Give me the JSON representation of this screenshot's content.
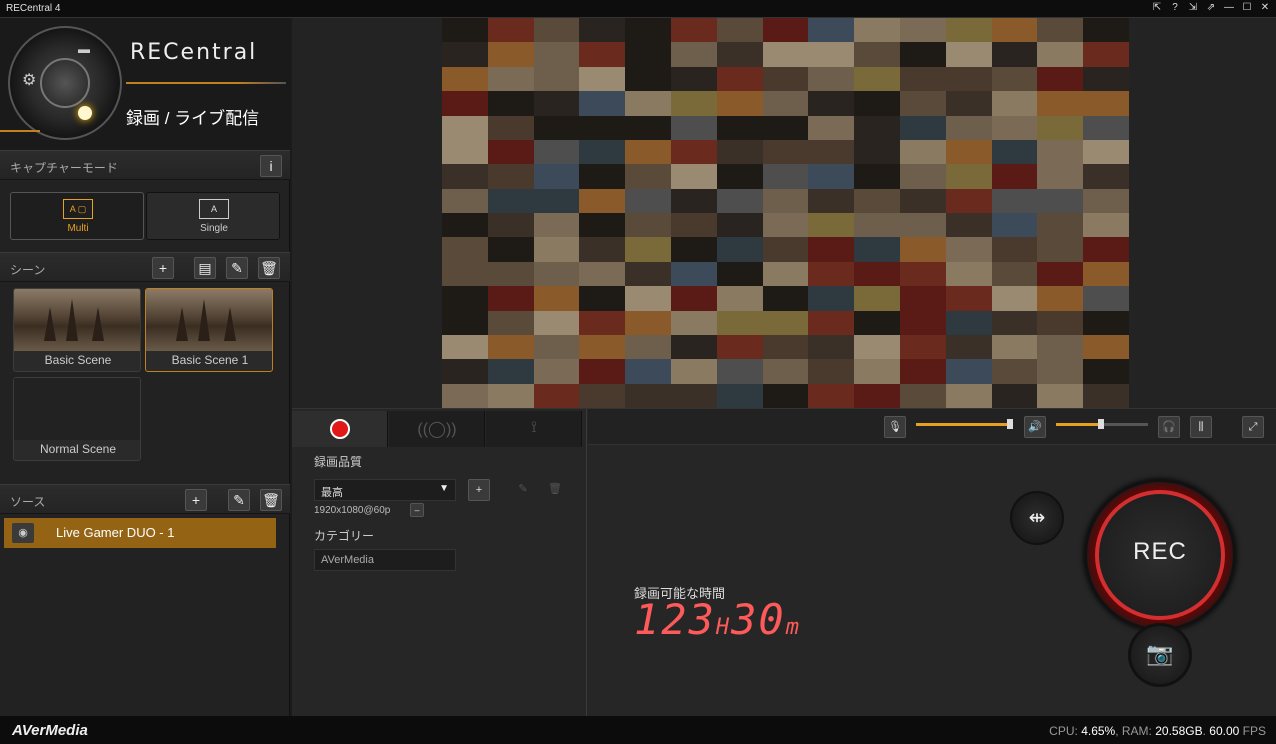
{
  "window": {
    "title": "RECentral 4",
    "controls": [
      "⇱",
      "?",
      "⇲",
      "⇗",
      "—",
      "☐",
      "✕"
    ]
  },
  "brand": {
    "logo": "RECentral",
    "mode": "録画 / ライブ配信"
  },
  "capture_mode": {
    "label": "キャプチャーモード",
    "info": "i",
    "options": [
      {
        "icon": "A ▢",
        "label": "Multi",
        "selected": true
      },
      {
        "icon": "A",
        "label": "Single",
        "selected": false
      }
    ]
  },
  "scenes": {
    "label": "シーン",
    "items": [
      {
        "name": "Basic Scene",
        "selected": false
      },
      {
        "name": "Basic Scene 1",
        "selected": true
      },
      {
        "name": "Normal Scene",
        "selected": false
      }
    ]
  },
  "sources": {
    "label": "ソース",
    "items": [
      {
        "name": "Live Gamer DUO - 1"
      }
    ]
  },
  "recording": {
    "quality_label": "録画品質",
    "quality_value": "最高",
    "resolution": "1920x1080@60p",
    "category_label": "カテゴリー",
    "category_value": "AVerMedia",
    "time_label": "録画可能な時間",
    "hours": "123",
    "h_unit": "H",
    "minutes": "30",
    "m_unit": "m",
    "rec_button": "REC"
  },
  "audio": {
    "mic_level": 0.98,
    "speaker_level": 0.49
  },
  "status": {
    "brand": "AVerMedia",
    "cpu_label": "CPU:",
    "cpu": "4.65%",
    "ram_label": "RAM:",
    "ram": "20.58GB",
    "fps": "60.00",
    "fps_label": "FPS"
  },
  "colors": {
    "accent": "#e8a020",
    "rec": "#d23030",
    "source_highlight": "#946414"
  }
}
